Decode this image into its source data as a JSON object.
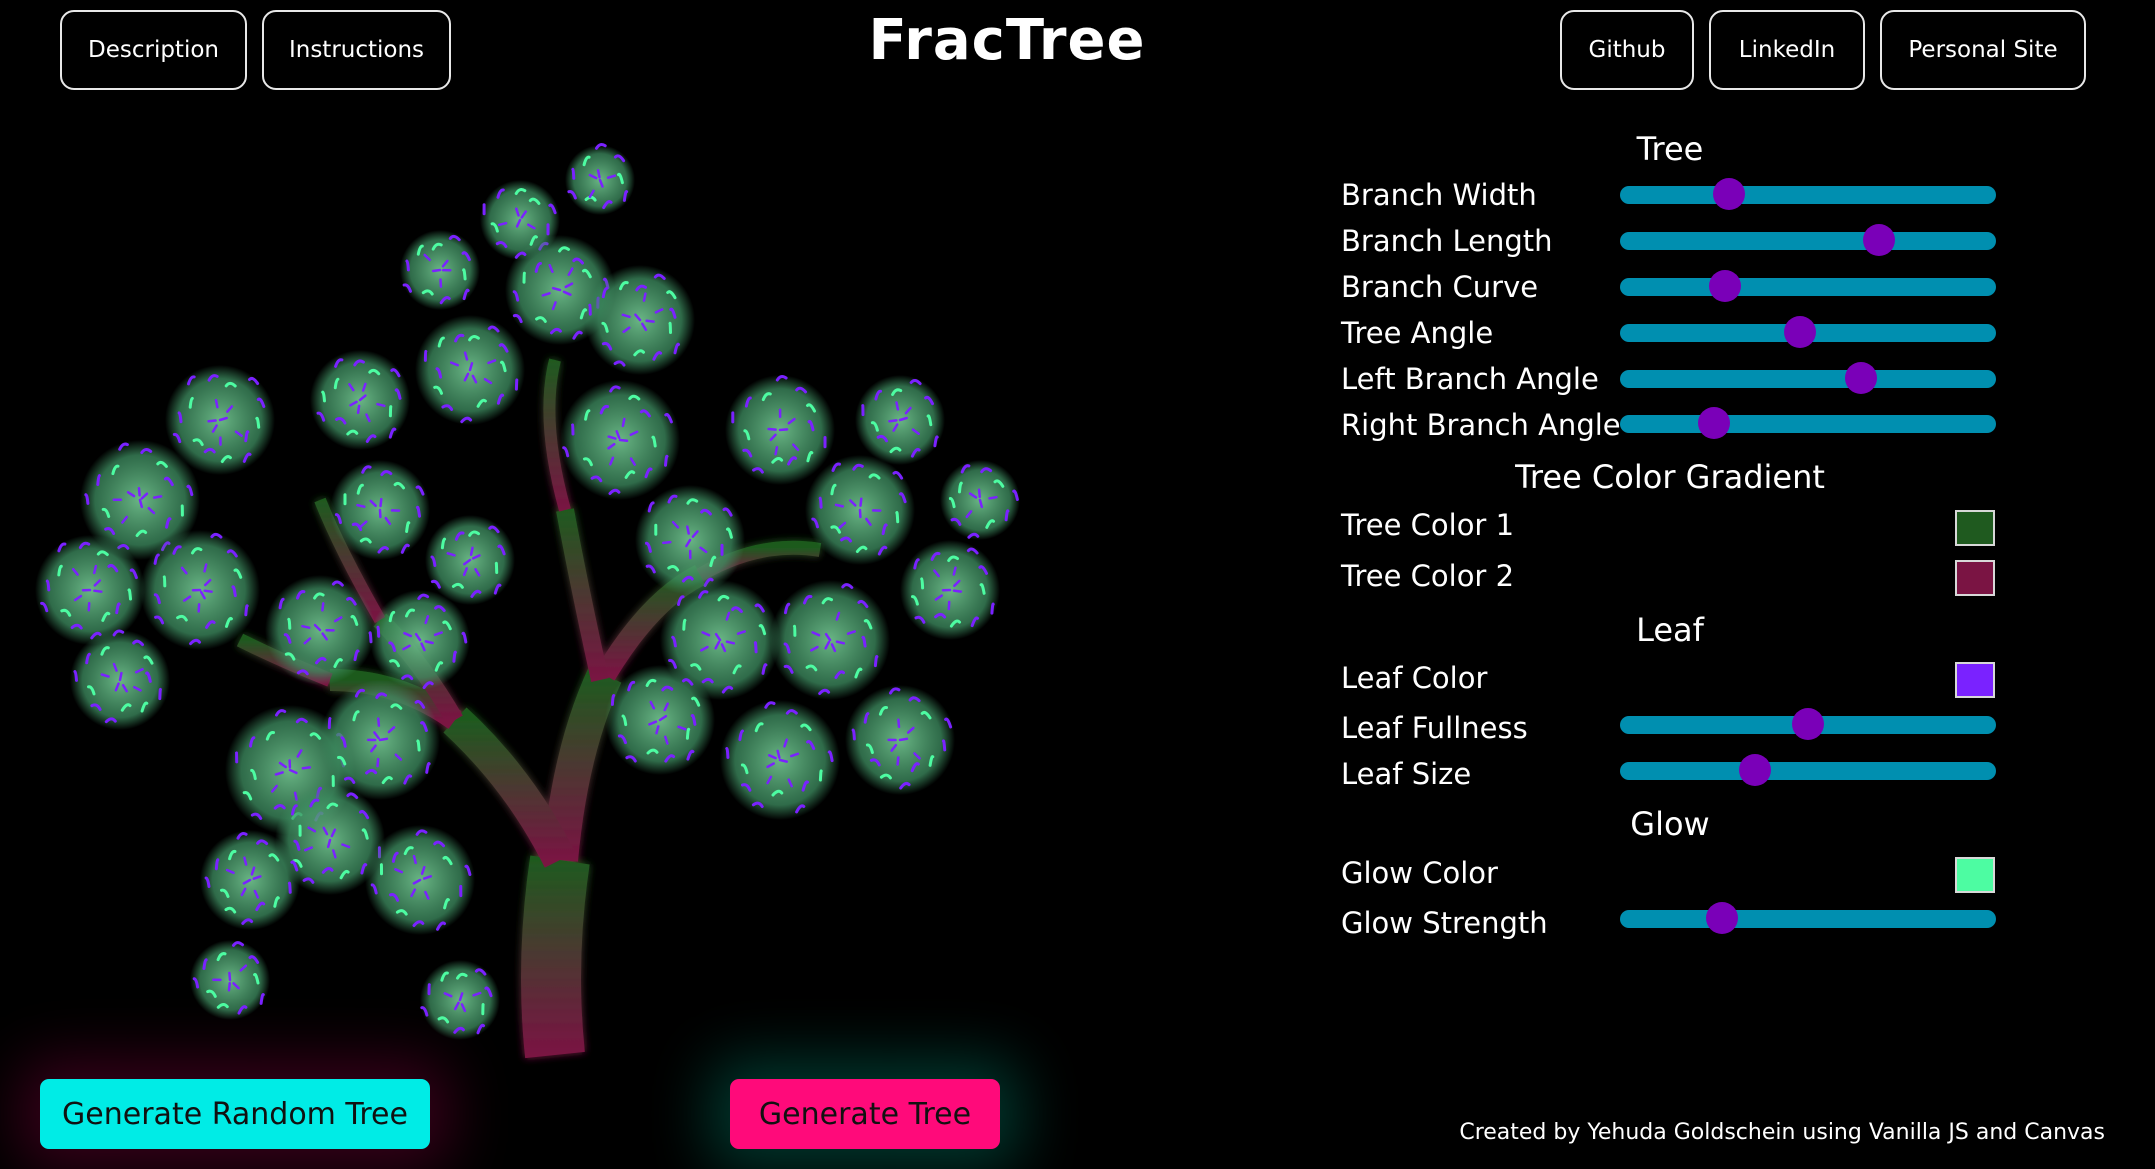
{
  "header": {
    "title": "FracTree",
    "left_buttons": [
      "Description",
      "Instructions"
    ],
    "right_buttons": [
      "Github",
      "LinkedIn",
      "Personal Site"
    ]
  },
  "panel": {
    "sections": {
      "tree": "Tree",
      "gradient": "Tree Color Gradient",
      "leaf": "Leaf",
      "glow": "Glow"
    },
    "sliders": [
      {
        "label": "Branch Width",
        "value": 0.29
      },
      {
        "label": "Branch Length",
        "value": 0.69
      },
      {
        "label": "Branch Curve",
        "value": 0.28
      },
      {
        "label": "Tree Angle",
        "value": 0.48
      },
      {
        "label": "Left Branch Angle",
        "value": 0.64
      },
      {
        "label": "Right Branch Angle",
        "value": 0.25
      },
      {
        "label": "Leaf Fullness",
        "value": 0.5
      },
      {
        "label": "Leaf Size",
        "value": 0.36
      },
      {
        "label": "Glow Strength",
        "value": 0.27
      }
    ],
    "colors": [
      {
        "label": "Tree Color 1",
        "color": "#1f5a1f"
      },
      {
        "label": "Tree Color 2",
        "color": "#7a1443"
      },
      {
        "label": "Leaf Color",
        "color": "#7a22ff"
      },
      {
        "label": "Glow Color",
        "color": "#4dfca2"
      }
    ]
  },
  "actions": {
    "random": "Generate Random Tree",
    "generate": "Generate Tree"
  },
  "footer": "Created by Yehuda Goldschein using Vanilla JS and Canvas"
}
